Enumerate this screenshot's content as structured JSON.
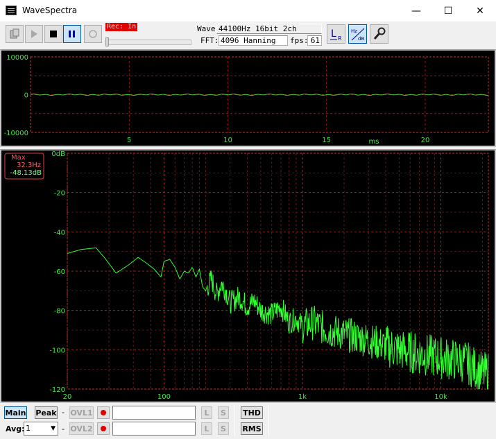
{
  "window": {
    "title": "WaveSpectra",
    "minimize_glyph": "—",
    "maximize_glyph": "☐",
    "close_glyph": "✕"
  },
  "toolbar": {
    "rec_status": "Rec: In",
    "wave_label": "Wave:",
    "wave_value": "44100Hz 16bit 2ch",
    "fft_label": "FFT:",
    "fft_value": "4096 Hanning",
    "fps_label": "fps:",
    "fps_value": "61",
    "lr_button": "L R",
    "hz_db_button": "Hz dB",
    "level_fraction": 0.0
  },
  "wave_chart": {
    "y_ticks": [
      "10000",
      "0",
      "-10000"
    ],
    "x_ticks": [
      "5",
      "10",
      "15",
      "20"
    ],
    "x_unit": "ms",
    "y_range": [
      -10000,
      10000
    ],
    "x_range_ms": [
      0,
      23.2
    ]
  },
  "spectrum_chart": {
    "max_label": "Max",
    "max_freq": "32.3Hz",
    "max_level": "-48.13dB",
    "y_ticks": [
      "0dB",
      "-20",
      "-40",
      "-60",
      "-80",
      "-100",
      "-120"
    ],
    "x_ticks": [
      "20",
      "100",
      "1k",
      "10k"
    ]
  },
  "chart_data": {
    "type": "line",
    "xscale": "log",
    "xlim": [
      20,
      22050
    ],
    "ylim": [
      -120,
      0
    ],
    "ylabel": "dB",
    "series": [
      {
        "x": [
          20,
          25,
          32.3,
          38,
          45,
          55,
          65,
          75,
          85,
          95,
          100,
          110,
          120,
          130,
          140,
          150,
          160,
          170,
          180,
          190,
          200,
          220,
          240,
          260,
          280,
          300,
          350,
          400,
          450,
          500,
          600,
          700,
          800,
          900,
          1000,
          1200,
          1500,
          2000,
          3000,
          4000,
          5000,
          7000,
          10000,
          15000,
          20000
        ],
        "y": [
          -51,
          -49,
          -48.13,
          -54,
          -61,
          -57,
          -53,
          -56,
          -59,
          -63,
          -55,
          -54,
          -58,
          -64,
          -60,
          -61,
          -58,
          -63,
          -59,
          -68,
          -70,
          -64,
          -72,
          -66,
          -70,
          -76,
          -73,
          -78,
          -75,
          -80,
          -82,
          -78,
          -86,
          -84,
          -88,
          -86,
          -90,
          -92,
          -95,
          -98,
          -100,
          -102,
          -104,
          -106,
          -112
        ]
      }
    ]
  },
  "bottom": {
    "main_button": "Main",
    "peak_button": "Peak",
    "dash": "-",
    "ovl1_button": "OVL1",
    "ovl2_button": "OVL2",
    "avg_label": "Avg:",
    "avg_value": "1",
    "l_button": "L",
    "s_button": "S",
    "thd_button": "THD",
    "rms_button": "RMS"
  }
}
